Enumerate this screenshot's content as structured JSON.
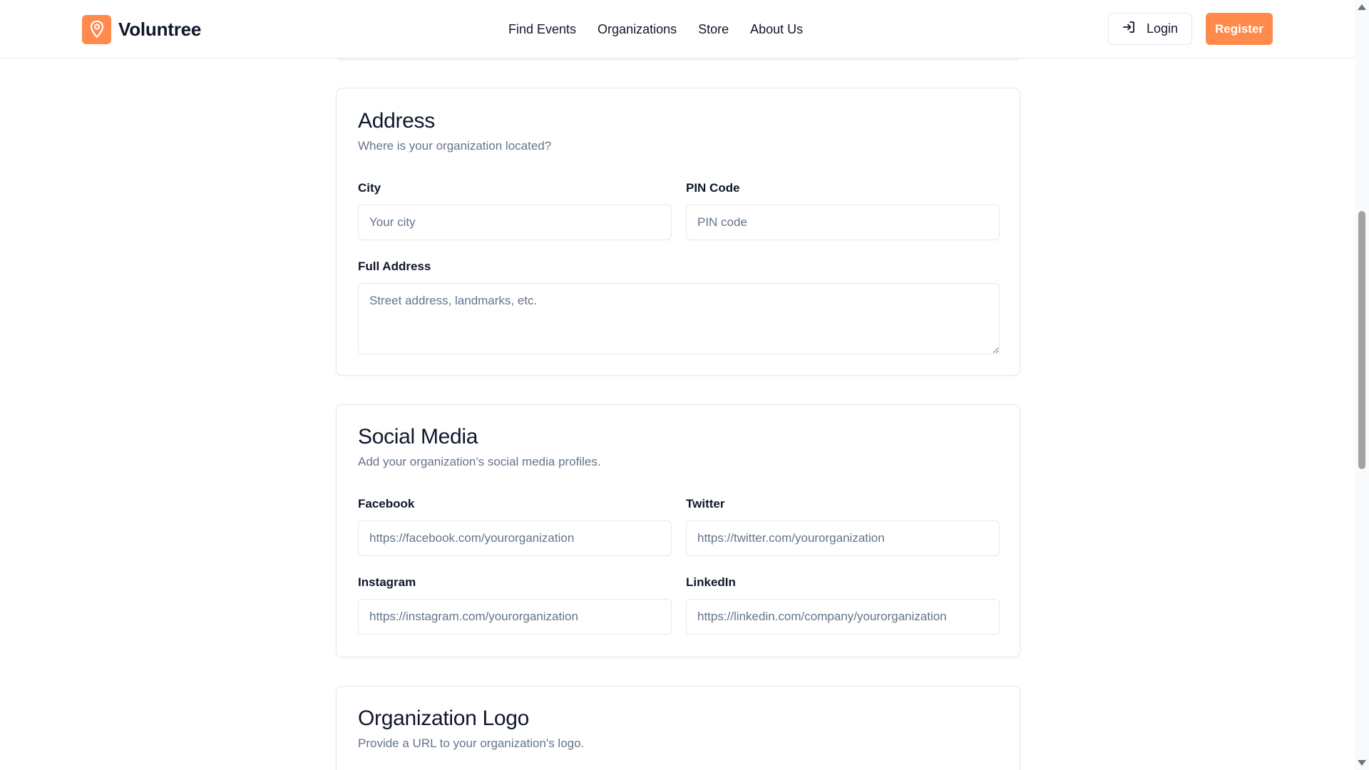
{
  "colors": {
    "accent": "#ff8a4c"
  },
  "header": {
    "brand": "Voluntree",
    "logo_icon": "map-pin-icon",
    "nav": [
      "Find Events",
      "Organizations",
      "Store",
      "About Us"
    ],
    "login_label": "Login",
    "login_icon": "login-arrow-icon",
    "register_label": "Register"
  },
  "address": {
    "title": "Address",
    "subtitle": "Where is your organization located?",
    "city_label": "City",
    "city_placeholder": "Your city",
    "pin_label": "PIN Code",
    "pin_placeholder": "PIN code",
    "full_label": "Full Address",
    "full_placeholder": "Street address, landmarks, etc."
  },
  "social": {
    "title": "Social Media",
    "subtitle": "Add your organization's social media profiles.",
    "facebook_label": "Facebook",
    "facebook_placeholder": "https://facebook.com/yourorganization",
    "twitter_label": "Twitter",
    "twitter_placeholder": "https://twitter.com/yourorganization",
    "instagram_label": "Instagram",
    "instagram_placeholder": "https://instagram.com/yourorganization",
    "linkedin_label": "LinkedIn",
    "linkedin_placeholder": "https://linkedin.com/company/yourorganization"
  },
  "logo_section": {
    "title": "Organization Logo",
    "subtitle": "Provide a URL to your organization's logo."
  }
}
